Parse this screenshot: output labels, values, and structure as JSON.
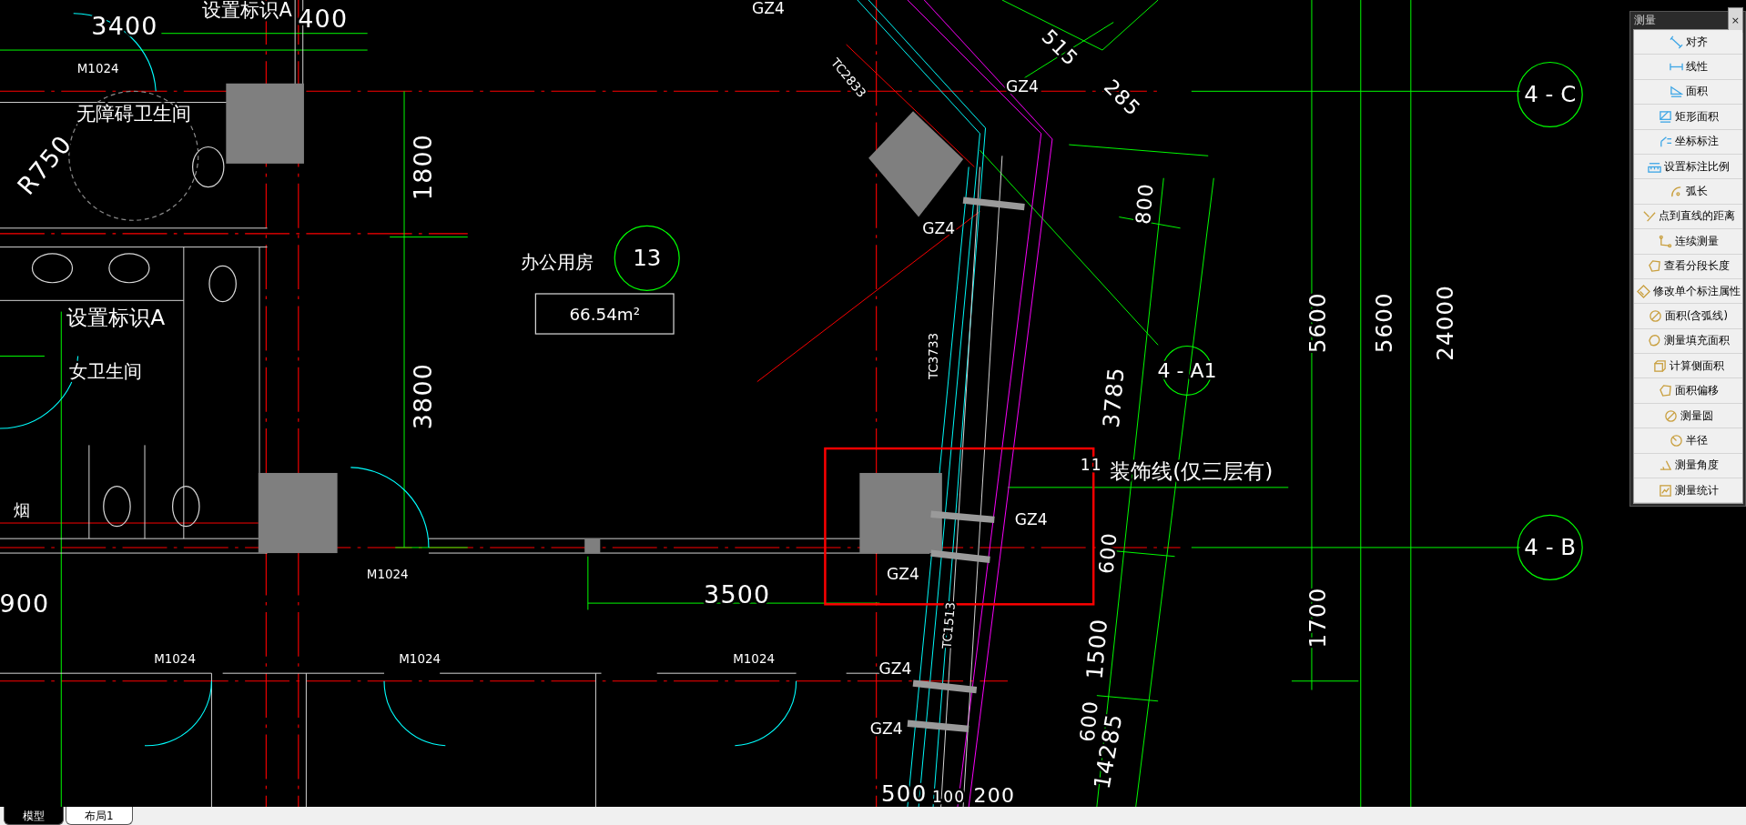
{
  "drawing": {
    "labels": [
      {
        "text": "设置标识A",
        "kind": "note"
      },
      {
        "text": "GZ4",
        "kind": "tag"
      },
      {
        "text": "3400",
        "kind": "dimension"
      },
      {
        "text": "400",
        "kind": "dimension"
      },
      {
        "text": "TC2833",
        "kind": "tag"
      },
      {
        "text": "515",
        "kind": "dimension"
      },
      {
        "text": "M1024",
        "kind": "tag"
      },
      {
        "text": "GZ4",
        "kind": "tag"
      },
      {
        "text": "285",
        "kind": "dimension"
      },
      {
        "text": "4 - C",
        "kind": "axis"
      },
      {
        "text": "无障碍卫生间",
        "kind": "room"
      },
      {
        "text": "R750",
        "kind": "dimension"
      },
      {
        "text": "1800",
        "kind": "dimension"
      },
      {
        "text": "800",
        "kind": "dimension"
      },
      {
        "text": "GZ4",
        "kind": "tag"
      },
      {
        "text": "办公用房",
        "kind": "room"
      },
      {
        "text": "13",
        "kind": "axis"
      },
      {
        "text": "66.54m²",
        "kind": "area"
      },
      {
        "text": "5600",
        "kind": "dimension"
      },
      {
        "text": "5600",
        "kind": "dimension"
      },
      {
        "text": "24000",
        "kind": "dimension"
      },
      {
        "text": "设置标识A",
        "kind": "note"
      },
      {
        "text": "TC3733",
        "kind": "tag"
      },
      {
        "text": "3785",
        "kind": "dimension"
      },
      {
        "text": "4 - A1",
        "kind": "axis"
      },
      {
        "text": "女卫生间",
        "kind": "room"
      },
      {
        "text": "3800",
        "kind": "dimension"
      },
      {
        "text": "11",
        "kind": "dimension"
      },
      {
        "text": "装饰线(仅三层有)",
        "kind": "note"
      },
      {
        "text": "烟",
        "kind": "note"
      },
      {
        "text": "GZ4",
        "kind": "tag"
      },
      {
        "text": "4 - B",
        "kind": "axis"
      },
      {
        "text": "600",
        "kind": "dimension"
      },
      {
        "text": "M1024",
        "kind": "tag"
      },
      {
        "text": "GZ4",
        "kind": "tag"
      },
      {
        "text": "3500",
        "kind": "dimension"
      },
      {
        "text": "900",
        "kind": "dimension"
      },
      {
        "text": "TC1513",
        "kind": "tag"
      },
      {
        "text": "1700",
        "kind": "dimension"
      },
      {
        "text": "1500",
        "kind": "dimension"
      },
      {
        "text": "M1024",
        "kind": "tag"
      },
      {
        "text": "M1024",
        "kind": "tag"
      },
      {
        "text": "M1024",
        "kind": "tag"
      },
      {
        "text": "GZ4",
        "kind": "tag"
      },
      {
        "text": "600",
        "kind": "dimension"
      },
      {
        "text": "GZ4",
        "kind": "tag"
      },
      {
        "text": "14285",
        "kind": "dimension"
      },
      {
        "text": "500",
        "kind": "dimension"
      },
      {
        "text": "100",
        "kind": "dimension"
      },
      {
        "text": "200",
        "kind": "dimension"
      }
    ]
  },
  "panel": {
    "title": "测量",
    "close": "×",
    "tools": [
      {
        "label": "对齐"
      },
      {
        "label": "线性"
      },
      {
        "label": "面积"
      },
      {
        "label": "矩形面积"
      },
      {
        "label": "坐标标注"
      },
      {
        "label": "设置标注比例"
      },
      {
        "label": "弧长"
      },
      {
        "label": "点到直线的距离"
      },
      {
        "label": "连续测量"
      },
      {
        "label": "查看分段长度"
      },
      {
        "label": "修改单个标注属性"
      },
      {
        "label": "面积(含弧线)"
      },
      {
        "label": "测量填充面积"
      },
      {
        "label": "计算侧面积"
      },
      {
        "label": "面积偏移"
      },
      {
        "label": "测量圆"
      },
      {
        "label": "半径"
      },
      {
        "label": "测量角度"
      },
      {
        "label": "测量统计"
      }
    ]
  },
  "layout_tabs": [
    {
      "label": "模型",
      "selected": true
    },
    {
      "label": "布局1",
      "selected": false
    }
  ]
}
